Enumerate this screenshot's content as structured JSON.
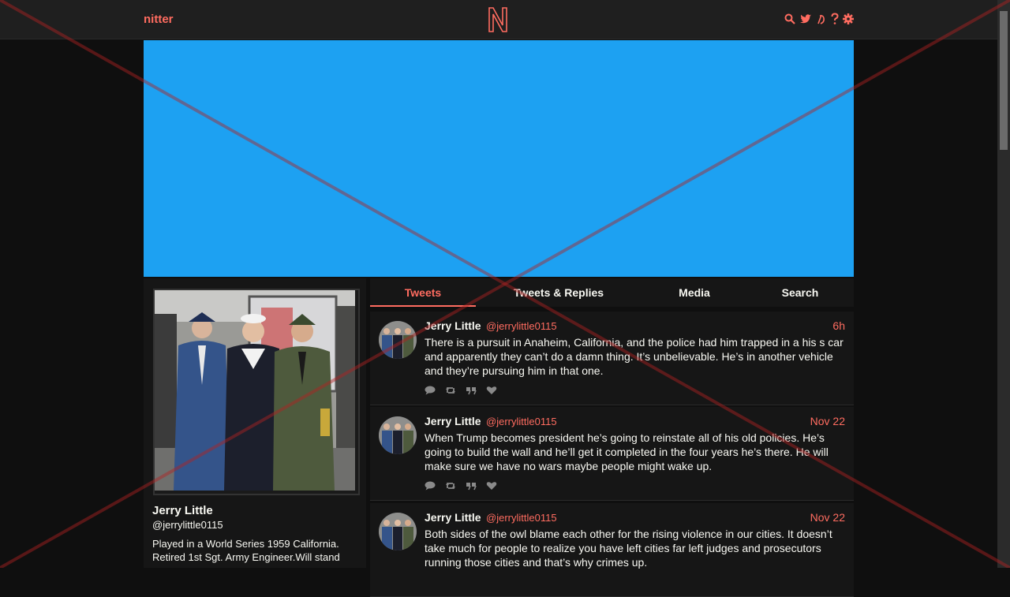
{
  "navbar": {
    "logo_text": "nitter",
    "emblem_letter": "N",
    "icons": [
      "search-icon",
      "twitter-bird-icon",
      "rss-icon",
      "help-icon",
      "gear-icon"
    ]
  },
  "colors": {
    "accent": "#ff6c60",
    "banner": "#1da1f2",
    "background": "#0f0f0f",
    "panel": "#161616",
    "overlay_cross": "#b22222"
  },
  "profile": {
    "name": "Jerry Little",
    "handle": "@jerrylittle0115",
    "bio": "Played in a World Series 1959 California. Retired 1st Sgt. Army Engineer.Will stand"
  },
  "tabs": [
    {
      "label": "Tweets",
      "active": true
    },
    {
      "label": "Tweets & Replies",
      "active": false
    },
    {
      "label": "Media",
      "active": false
    },
    {
      "label": "Search",
      "active": false
    }
  ],
  "tweets": [
    {
      "name": "Jerry Little",
      "handle": "@jerrylittle0115",
      "date": "6h",
      "text": "There is a pursuit in Anaheim, California, and the police had him trapped in a his s car and apparently they can’t do a damn thing. It’s unbelievable. He’s in another vehicle and they’re pursuing him in that one."
    },
    {
      "name": "Jerry Little",
      "handle": "@jerrylittle0115",
      "date": "Nov 22",
      "text": "When Trump becomes president he’s going to reinstate all of his old policies. He’s going to build the wall and he’ll get it completed in the four years he’s there. He will make sure we have no wars maybe people might wake up."
    },
    {
      "name": "Jerry Little",
      "handle": "@jerrylittle0115",
      "date": "Nov 22",
      "text": "Both sides of the owl blame each other for the rising violence in our cities. It doesn’t take much for people to realize you have left cities far left judges and prosecutors running those cities and that’s why crimes up."
    }
  ],
  "tweet_stat_icons": [
    "comment-icon",
    "retweet-icon",
    "quote-icon",
    "heart-icon"
  ]
}
